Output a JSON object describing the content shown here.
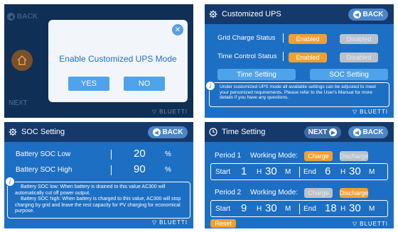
{
  "panel1": {
    "back_label": "BACK",
    "next_label": "NEXT",
    "dialog_title": "Enable Customized UPS Mode",
    "yes_label": "YES",
    "no_label": "NO",
    "brand": "BLUETTI"
  },
  "panel2": {
    "title": "Customized UPS",
    "back_label": "BACK",
    "rows": [
      {
        "label": "Grid Charge Status",
        "enabled": "Enabled",
        "disabled": "Disabled"
      },
      {
        "label": "Time Control Status",
        "enabled": "Enabled",
        "disabled": "Disabled"
      }
    ],
    "time_setting_label": "Time Setting",
    "soc_setting_label": "SOC Setting",
    "info_text": "Under customized UPS mode all available settings can be adjusted to meet your personized requirements. Please refer to the User's Manual for more details if you have any questions.",
    "brand": "BLUETTI"
  },
  "panel3": {
    "title": "SOC Setting",
    "back_label": "BACK",
    "rows": [
      {
        "label": "Battery SOC Low",
        "value": "20",
        "unit": "%"
      },
      {
        "label": "Battery SOC High",
        "value": "90",
        "unit": "%"
      }
    ],
    "info_line1": "Battery SOC low:  When battery is drained to this value AC300 will automatically cut off power output.",
    "info_line2": "Battery SOC high:  When battery is charged to this value, AC300 will stop charging by grid and leave the rest capacity for PV charging for economical purpose.",
    "brand": "BLUETTI"
  },
  "panel4": {
    "title": "Time Setting",
    "next_label": "NEXT",
    "back_label": "BACK",
    "periods": [
      {
        "label": "Period 1",
        "mode_label": "Working Mode:",
        "charge": "Charge",
        "discharge": "Discharge",
        "active": "charge",
        "start_label": "Start",
        "start_h": "1",
        "h": "H",
        "start_m": "30",
        "m": "M",
        "end_label": "End",
        "end_h": "6",
        "end_m": "30"
      },
      {
        "label": "Period 2",
        "mode_label": "Working Mode:",
        "charge": "Charge",
        "discharge": "Discharge",
        "active": "discharge",
        "start_label": "Start",
        "start_h": "9",
        "h": "H",
        "start_m": "30",
        "m": "M",
        "end_label": "End",
        "end_h": "18",
        "end_m": "30"
      }
    ],
    "reset_label": "Reset",
    "brand": "BLUETTI"
  }
}
